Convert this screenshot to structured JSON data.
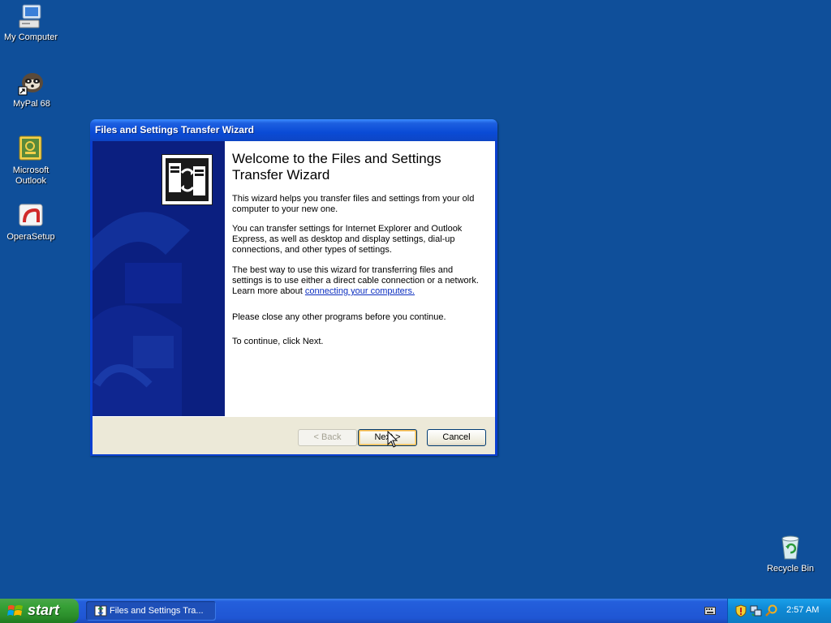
{
  "desktop": {
    "icons": [
      {
        "label": "My Computer",
        "icon": "my-computer-icon"
      },
      {
        "label": "MyPal 68",
        "icon": "mypal-icon"
      },
      {
        "label": "Microsoft Outlook",
        "icon": "outlook-icon"
      },
      {
        "label": "OperaSetup",
        "icon": "opera-setup-icon"
      },
      {
        "label": "Recycle Bin",
        "icon": "recycle-bin-icon"
      }
    ]
  },
  "window": {
    "title": "Files and Settings Transfer Wizard",
    "heading": "Welcome to the Files and Settings Transfer Wizard",
    "paragraphs": {
      "p1": "This wizard helps you transfer files and settings from your old computer to your new one.",
      "p2": "You can transfer settings for Internet Explorer and Outlook Express, as well as desktop and display settings, dial-up connections, and other types of settings.",
      "p3_before_link": "The best way to use this wizard for transferring files and settings is to use either a direct cable connection or a network. Learn more about ",
      "p3_link": "connecting your computers.",
      "p4": "Please close any other programs before you continue.",
      "p5": "To continue, click Next."
    },
    "buttons": {
      "back": "< Back",
      "next": "Next >",
      "cancel": "Cancel"
    }
  },
  "taskbar": {
    "start_label": "start",
    "task_button_label": "Files and Settings Tra...",
    "clock": "2:57 AM",
    "tray_icons": [
      "keyboard-icon",
      "security-shield-icon",
      "network-icon",
      "search-icon"
    ]
  },
  "colors": {
    "desktop_background": "#0f4f9a",
    "titlebar": "#0a4bd6",
    "wizard_sidebar": "#0b1f80",
    "start_button": "#37a137",
    "taskbar": "#245fdc",
    "tray": "#0f8ad6"
  }
}
